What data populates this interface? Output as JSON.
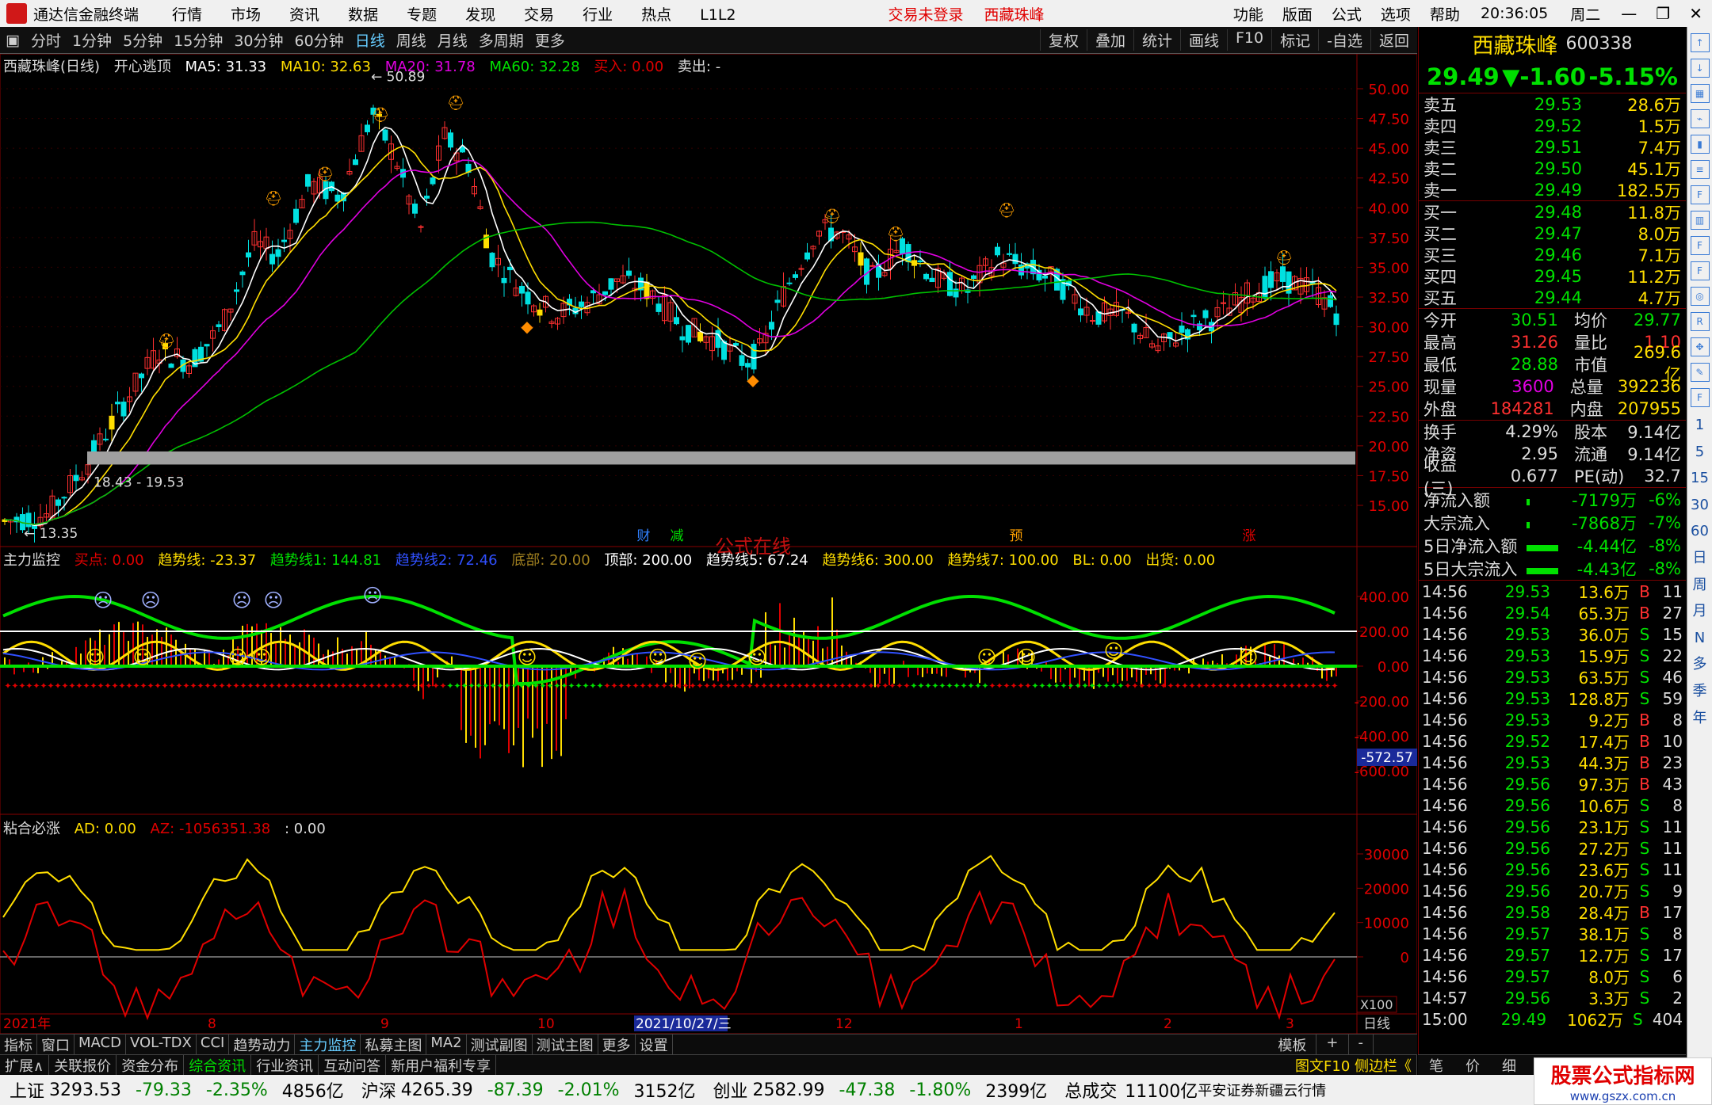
{
  "window": {
    "app_name": "通达信金融终端",
    "menu": [
      "行情",
      "市场",
      "资讯",
      "数据",
      "专题",
      "发现",
      "交易",
      "行业",
      "热点",
      "L1L2"
    ],
    "status": "交易未登录",
    "status_stock": "西藏珠峰",
    "right_menu": [
      "功能",
      "版面",
      "公式",
      "选项",
      "帮助"
    ],
    "clock": "20:36:05",
    "weekday": "周二"
  },
  "toolbar": {
    "periods": [
      "分时",
      "1分钟",
      "5分钟",
      "15分钟",
      "30分钟",
      "60分钟",
      "日线",
      "周线",
      "月线",
      "多周期",
      "更多"
    ],
    "active_period": "日线",
    "right_buttons": [
      "复权",
      "叠加",
      "统计",
      "画线",
      "F10",
      "标记",
      "-自选",
      "返回"
    ]
  },
  "main_chart": {
    "legend": {
      "title": "西藏珠峰(日线)",
      "indicator": "开心逃顶",
      "ma5": "MA5: 31.33",
      "ma10": "MA10: 32.63",
      "ma20": "MA20: 31.78",
      "ma60": "MA60: 32.28",
      "buy": "买入: 0.00",
      "sell": "卖出: -"
    },
    "y_ticks": [
      "50.00",
      "47.50",
      "45.00",
      "42.50",
      "40.00",
      "37.50",
      "35.00",
      "32.50",
      "30.00",
      "27.50",
      "25.00",
      "22.50",
      "20.00",
      "17.50",
      "15.00"
    ],
    "annotations": {
      "high": "50.89",
      "low": "13.35",
      "band": "18.43 - 19.53"
    },
    "markers": [
      "财",
      "减",
      "预",
      "涨"
    ],
    "watermark": "公式在线"
  },
  "indicator1": {
    "legend": {
      "name": "主力监控",
      "buy_point": "买点: 0.00",
      "trend": "趋势线: -23.37",
      "trend1": "趋势线1: 144.81",
      "trend2": "趋势线2: 72.46",
      "bottom": "底部: 20.00",
      "top": "顶部: 200.00",
      "trend5": "趋势线5: 67.24",
      "trend6": "趋势线6: 300.00",
      "trend7": "趋势线7: 100.00",
      "bl": "BL: 0.00",
      "ship": "出货: 0.00"
    },
    "y_ticks": [
      "400.00",
      "200.00",
      "0.00",
      "-200.00",
      "-400.00",
      "-600.00"
    ],
    "cursor_value": "-572.57"
  },
  "indicator2": {
    "legend": {
      "name": "粘合必涨",
      "ad": "AD: 0.00",
      "az": "AZ: -1056351.38",
      "extra": ": 0.00"
    },
    "y_ticks": [
      "30000",
      "20000",
      "10000",
      "0"
    ],
    "scale": "X100"
  },
  "x_axis": {
    "labels": [
      "2021年",
      "8",
      "9",
      "10",
      "2021/10/27/三",
      "12",
      "1",
      "2",
      "3"
    ],
    "period": "日线"
  },
  "quote": {
    "name": "西藏珠峰",
    "code": "600338",
    "price": "29.49",
    "change": "▼-1.60",
    "change_pct": "-5.15%",
    "asks": [
      {
        "label": "卖五",
        "price": "29.53",
        "vol": "28.6万"
      },
      {
        "label": "卖四",
        "price": "29.52",
        "vol": "1.5万"
      },
      {
        "label": "卖三",
        "price": "29.51",
        "vol": "7.4万"
      },
      {
        "label": "卖二",
        "price": "29.50",
        "vol": "45.1万"
      },
      {
        "label": "卖一",
        "price": "29.49",
        "vol": "182.5万"
      }
    ],
    "bids": [
      {
        "label": "买一",
        "price": "29.48",
        "vol": "11.8万"
      },
      {
        "label": "买二",
        "price": "29.47",
        "vol": "8.0万"
      },
      {
        "label": "买三",
        "price": "29.46",
        "vol": "7.1万"
      },
      {
        "label": "买四",
        "price": "29.45",
        "vol": "11.2万"
      },
      {
        "label": "买五",
        "price": "29.44",
        "vol": "4.7万"
      }
    ],
    "stats": [
      {
        "l": "今开",
        "v": "30.51",
        "l2": "均价",
        "v2": "29.77"
      },
      {
        "l": "最高",
        "v": "31.26",
        "l2": "量比",
        "v2": "1.10"
      },
      {
        "l": "最低",
        "v": "28.88",
        "l2": "市值",
        "v2": "269.6亿"
      },
      {
        "l": "现量",
        "v": "3600",
        "l2": "总量",
        "v2": "392236"
      },
      {
        "l": "外盘",
        "v": "184281",
        "l2": "内盘",
        "v2": "207955"
      }
    ],
    "stats2": [
      {
        "l": "换手",
        "v": "4.29%",
        "l2": "股本",
        "v2": "9.14亿"
      },
      {
        "l": "净资",
        "v": "2.95",
        "l2": "流通",
        "v2": "9.14亿"
      },
      {
        "l": "收益(三)",
        "v": "0.677",
        "l2": "PE(动)",
        "v2": "32.7"
      }
    ],
    "flows": [
      {
        "l": "净流入额",
        "v": "-7179万",
        "p": "-6%"
      },
      {
        "l": "大宗流入",
        "v": "-7868万",
        "p": "-7%"
      },
      {
        "l": "5日净流入额",
        "v": "-4.44亿",
        "p": "-8%"
      },
      {
        "l": "5日大宗流入",
        "v": "-4.43亿",
        "p": "-8%"
      }
    ],
    "ticks": [
      {
        "t": "14:56",
        "p": "29.53",
        "v": "13.6万",
        "bs": "B",
        "n": "11"
      },
      {
        "t": "14:56",
        "p": "29.54",
        "v": "65.3万",
        "bs": "B",
        "n": "27"
      },
      {
        "t": "14:56",
        "p": "29.53",
        "v": "36.0万",
        "bs": "S",
        "n": "15"
      },
      {
        "t": "14:56",
        "p": "29.53",
        "v": "15.9万",
        "bs": "S",
        "n": "22"
      },
      {
        "t": "14:56",
        "p": "29.53",
        "v": "63.5万",
        "bs": "S",
        "n": "46"
      },
      {
        "t": "14:56",
        "p": "29.53",
        "v": "128.8万",
        "bs": "S",
        "n": "59"
      },
      {
        "t": "14:56",
        "p": "29.53",
        "v": "9.2万",
        "bs": "B",
        "n": "8"
      },
      {
        "t": "14:56",
        "p": "29.52",
        "v": "17.4万",
        "bs": "B",
        "n": "10"
      },
      {
        "t": "14:56",
        "p": "29.53",
        "v": "44.3万",
        "bs": "B",
        "n": "23"
      },
      {
        "t": "14:56",
        "p": "29.56",
        "v": "97.3万",
        "bs": "B",
        "n": "43"
      },
      {
        "t": "14:56",
        "p": "29.56",
        "v": "10.6万",
        "bs": "S",
        "n": "8"
      },
      {
        "t": "14:56",
        "p": "29.56",
        "v": "23.1万",
        "bs": "S",
        "n": "11"
      },
      {
        "t": "14:56",
        "p": "29.56",
        "v": "27.2万",
        "bs": "S",
        "n": "11"
      },
      {
        "t": "14:56",
        "p": "29.56",
        "v": "23.6万",
        "bs": "S",
        "n": "11"
      },
      {
        "t": "14:56",
        "p": "29.56",
        "v": "20.7万",
        "bs": "S",
        "n": "9"
      },
      {
        "t": "14:56",
        "p": "29.58",
        "v": "28.4万",
        "bs": "B",
        "n": "17"
      },
      {
        "t": "14:56",
        "p": "29.57",
        "v": "38.1万",
        "bs": "S",
        "n": "8"
      },
      {
        "t": "14:56",
        "p": "29.57",
        "v": "12.7万",
        "bs": "S",
        "n": "17"
      },
      {
        "t": "14:56",
        "p": "29.57",
        "v": "8.0万",
        "bs": "S",
        "n": "6"
      },
      {
        "t": "14:57",
        "p": "29.56",
        "v": "3.3万",
        "bs": "S",
        "n": "2"
      },
      {
        "t": "15:00",
        "p": "29.49",
        "v": "1062万",
        "bs": "S",
        "n": "404"
      }
    ],
    "footer": [
      "笔",
      "价",
      "细",
      "势"
    ]
  },
  "bottom_tabs": [
    "指标",
    "窗口",
    "MACD",
    "VOL-TDX",
    "CCI",
    "趋势动力",
    "主力监控",
    "私募主图",
    "MA2",
    "测试副图",
    "测试主图",
    "更多",
    "设置"
  ],
  "bottom_tabs_active": "主力监控",
  "bottom_tabs_right": [
    "模板",
    "+",
    "-"
  ],
  "bottom_tabs2": [
    "扩展∧",
    "关联报价",
    "资金分布",
    "综合资讯",
    "行业资讯",
    "互动问答",
    "新用户福利专享"
  ],
  "bottom_tabs2_right": "图文F10 侧边栏《",
  "statusbar": {
    "sh_label": "上证",
    "sh_val": "3293.53",
    "sh_chg": "-79.33",
    "sh_pct": "-2.35%",
    "sh_amt": "4856亿",
    "sz_label": "沪深",
    "sz_val": "4265.39",
    "sz_chg": "-87.39",
    "sz_pct": "-2.01%",
    "sz_amt": "3152亿",
    "cy_label": "创业",
    "cy_val": "2582.99",
    "cy_chg": "-47.38",
    "cy_pct": "-1.80%",
    "cy_amt": "2399亿",
    "total_label": "总成交",
    "total_amt": "11100亿",
    "broker": "平安证券新疆云行情"
  },
  "site_watermark": {
    "title": "股票公式指标网",
    "url": "www.gszx.com.cn"
  },
  "side_icons": [
    "up-arrow-icon",
    "down-arrow-icon",
    "grid-icon",
    "chart-icon",
    "candle-icon",
    "list-icon",
    "f10-icon",
    "bar-icon",
    "f10b-icon",
    "f12-icon",
    "circle-icon",
    "rsi-icon",
    "move-icon",
    "pen-icon",
    "fs-icon"
  ],
  "side_periods": [
    "1",
    "5",
    "15",
    "30",
    "60",
    "日",
    "周",
    "月",
    "N",
    "多",
    "季",
    "年"
  ]
}
